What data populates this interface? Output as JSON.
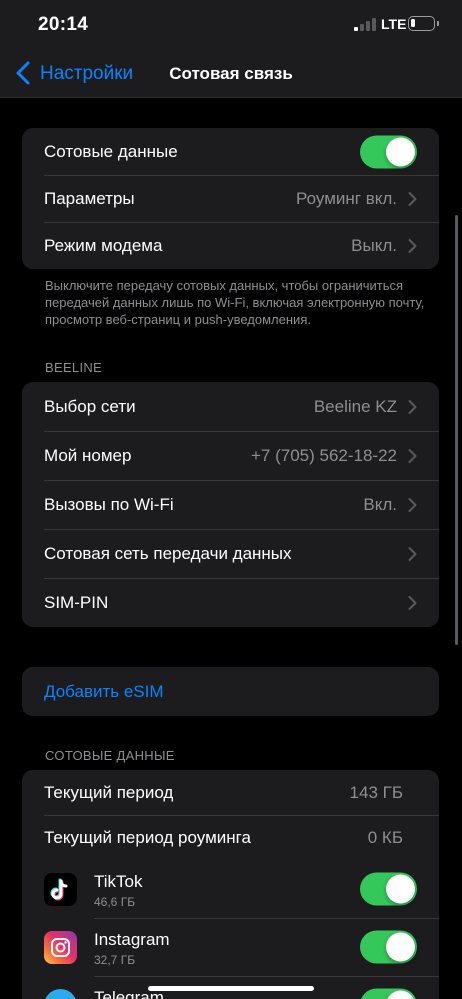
{
  "status_bar": {
    "time": "20:14",
    "network": "LTE",
    "battery_level": 0.15
  },
  "nav": {
    "back_label": "Настройки",
    "title": "Сотовая связь"
  },
  "group1": {
    "cellular_data": {
      "label": "Сотовые данные",
      "on": true
    },
    "options": {
      "label": "Параметры",
      "value": "Роуминг вкл."
    },
    "hotspot": {
      "label": "Режим модема",
      "value": "Выкл."
    }
  },
  "footnote": "Выключите передачу сотовых данных, чтобы ограничиться передачей данных лишь по Wi-Fi, включая электронную почту, просмотр веб-страниц и push-уведомления.",
  "carrier": {
    "header": "BEELINE",
    "network_selection": {
      "label": "Выбор сети",
      "value": "Beeline KZ"
    },
    "my_number": {
      "label": "Мой номер",
      "value": "+7 (705) 562-18-22"
    },
    "wifi_calling": {
      "label": "Вызовы по Wi-Fi",
      "value": "Вкл."
    },
    "cellular_data_network": {
      "label": "Сотовая сеть передачи данных"
    },
    "sim_pin": {
      "label": "SIM-PIN"
    }
  },
  "esim": {
    "label": "Добавить eSIM"
  },
  "usage": {
    "header": "СОТОВЫЕ ДАННЫЕ",
    "current_period": {
      "label": "Текущий период",
      "value": "143 ГБ"
    },
    "roaming_period": {
      "label": "Текущий период роуминга",
      "value": "0 КБ"
    },
    "apps": [
      {
        "name": "TikTok",
        "size": "46,6 ГБ",
        "icon": "tiktok-icon",
        "on": true
      },
      {
        "name": "Instagram",
        "size": "32,7 ГБ",
        "icon": "instagram-icon",
        "on": true
      },
      {
        "name": "Telegram",
        "size": "",
        "icon": "telegram-icon",
        "on": true
      }
    ]
  },
  "colors": {
    "accent": "#0a84ff",
    "toggle_on": "#34c759",
    "cell_bg": "#1c1c1e",
    "secondary_text": "#8e8e93"
  }
}
